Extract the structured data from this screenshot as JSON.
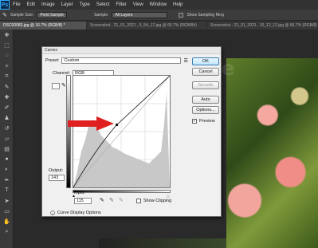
{
  "app": {
    "logo": "Ps"
  },
  "menu": [
    "File",
    "Edit",
    "Image",
    "Layer",
    "Type",
    "Select",
    "Filter",
    "View",
    "Window",
    "Help"
  ],
  "options": {
    "sample_size_label": "Sample Size:",
    "sample_size_value": "Point Sample",
    "sample_label": "Sample:",
    "sample_value": "All Layers",
    "show_ring_label": "Show Sampling Ring"
  },
  "tabs": [
    "DSC00083.jpg @ 16.7% (RGB/8) *",
    "Screenshot - 21_01_2021 , 5_54_17.jpg @ 66.7% (RGB/8#)",
    "Screenshot - 21_01_2021 , 10_12_12.jpg @ 66.7% (RGB/8)"
  ],
  "watermark": "BlundangOnline",
  "dialog": {
    "title": "Curves",
    "preset_label": "Preset:",
    "preset_value": "Custom",
    "channel_label": "Channel:",
    "channel_value": "RGB",
    "output_label": "Output:",
    "output_value": "143",
    "input_label": "Input:",
    "input_value": "115",
    "show_clipping_label": "Show Clipping",
    "display_options_label": "Curve Display Options",
    "buttons": {
      "ok": "OK",
      "cancel": "Cancel",
      "smooth": "Smooth",
      "auto": "Auto",
      "options": "Options..."
    },
    "preview_label": "Preview",
    "preview_checked": true
  },
  "curve": {
    "point_input": 115,
    "point_output": 143
  },
  "colors": {
    "arrow": "#e02020",
    "photo_accent": "#f4a8a0"
  },
  "tools": [
    "move-icon",
    "marquee-icon",
    "lasso-icon",
    "quick-select-icon",
    "crop-icon",
    "eyedropper-icon",
    "healing-icon",
    "brush-icon",
    "stamp-icon",
    "history-brush-icon",
    "eraser-icon",
    "gradient-icon",
    "blur-icon",
    "dodge-icon",
    "pen-icon",
    "type-icon",
    "path-select-icon",
    "shape-icon",
    "hand-icon",
    "zoom-icon"
  ]
}
